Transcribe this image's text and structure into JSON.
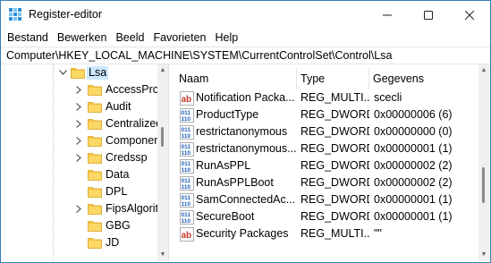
{
  "window": {
    "title": "Register-editor",
    "app_icon": "regedit-icon",
    "controls": {
      "minimize": "minimize-icon",
      "maximize": "maximize-icon",
      "close": "close-icon"
    }
  },
  "menu": [
    "Bestand",
    "Bewerken",
    "Beeld",
    "Favorieten",
    "Help"
  ],
  "address": "Computer\\HKEY_LOCAL_MACHINE\\SYSTEM\\CurrentControlSet\\Control\\Lsa",
  "tree": {
    "expanded": {
      "label": "Lsa",
      "icon": "folder-open-icon"
    },
    "children": [
      {
        "label": "AccessProv",
        "has_children": true
      },
      {
        "label": "Audit",
        "has_children": true
      },
      {
        "label": "Centralized",
        "has_children": true
      },
      {
        "label": "Componen",
        "has_children": true
      },
      {
        "label": "Credssp",
        "has_children": true
      },
      {
        "label": "Data",
        "has_children": false
      },
      {
        "label": "DPL",
        "has_children": false
      },
      {
        "label": "FipsAlgorit",
        "has_children": true
      },
      {
        "label": "GBG",
        "has_children": false
      },
      {
        "label": "JD",
        "has_children": false
      }
    ]
  },
  "list": {
    "columns": [
      "Naam",
      "Type",
      "Gegevens"
    ],
    "rows": [
      {
        "icon": "string-value-icon",
        "name": "Notification Packa...",
        "type": "REG_MULTI...",
        "data": "scecli"
      },
      {
        "icon": "binary-value-icon",
        "name": "ProductType",
        "type": "REG_DWORD",
        "data": "0x00000006 (6)"
      },
      {
        "icon": "binary-value-icon",
        "name": "restrictanonymous",
        "type": "REG_DWORD",
        "data": "0x00000000 (0)"
      },
      {
        "icon": "binary-value-icon",
        "name": "restrictanonymous...",
        "type": "REG_DWORD",
        "data": "0x00000001 (1)"
      },
      {
        "icon": "binary-value-icon",
        "name": "RunAsPPL",
        "type": "REG_DWORD",
        "data": "0x00000002 (2)"
      },
      {
        "icon": "binary-value-icon",
        "name": "RunAsPPLBoot",
        "type": "REG_DWORD",
        "data": "0x00000002 (2)"
      },
      {
        "icon": "binary-value-icon",
        "name": "SamConnectedAc...",
        "type": "REG_DWORD",
        "data": "0x00000001 (1)"
      },
      {
        "icon": "binary-value-icon",
        "name": "SecureBoot",
        "type": "REG_DWORD",
        "data": "0x00000001 (1)"
      },
      {
        "icon": "string-value-icon",
        "name": "Security Packages",
        "type": "REG_MULTI...",
        "data": "\"\""
      }
    ]
  },
  "colors": {
    "accent": "#0078d4",
    "selection": "#cce8ff",
    "folder": "#f6c343",
    "window_border": "#3c7fb1"
  }
}
